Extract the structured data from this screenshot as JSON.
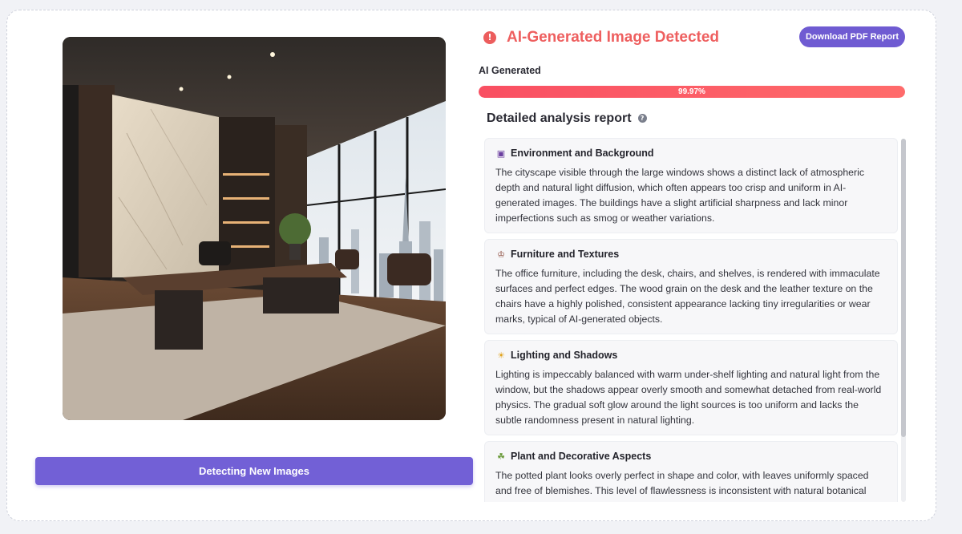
{
  "result": {
    "title": "AI-Generated Image Detected",
    "info_icon": "exclamation-circle-icon",
    "label": "AI Generated",
    "confidence": 99.97,
    "confidence_text": "99.97%"
  },
  "actions": {
    "download_pdf": "Download PDF Report",
    "detect_new": "Detecting New Images"
  },
  "report": {
    "title": "Detailed analysis report",
    "help_icon": "question-circle-icon",
    "items": [
      {
        "icon": "cityscape-icon",
        "title": "Environment and Background",
        "body": "The cityscape visible through the large windows shows a distinct lack of atmospheric depth and natural light diffusion, which often appears too crisp and uniform in AI-generated images. The buildings have a slight artificial sharpness and lack minor imperfections such as smog or weather variations."
      },
      {
        "icon": "chair-icon",
        "title": "Furniture and Textures",
        "body": "The office furniture, including the desk, chairs, and shelves, is rendered with immaculate surfaces and perfect edges. The wood grain on the desk and the leather texture on the chairs have a highly polished, consistent appearance lacking tiny irregularities or wear marks, typical of AI-generated objects."
      },
      {
        "icon": "lightbulb-icon",
        "title": "Lighting and Shadows",
        "body": "Lighting is impeccably balanced with warm under-shelf lighting and natural light from the window, but the shadows appear overly smooth and somewhat detached from real-world physics. The gradual soft glow around the light sources is too uniform and lacks the subtle randomness present in natural lighting."
      },
      {
        "icon": "plant-icon",
        "title": "Plant and Decorative Aspects",
        "body": "The potted plant looks overly perfect in shape and color, with leaves uniformly spaced and free of blemishes. This level of flawlessness is inconsistent with natural botanical variation, which is challenging for AI to replicate authentically."
      }
    ]
  },
  "colors": {
    "accent": "#7260d6",
    "alert": "#ee5f5f",
    "bar_fill": "#f94f62"
  }
}
